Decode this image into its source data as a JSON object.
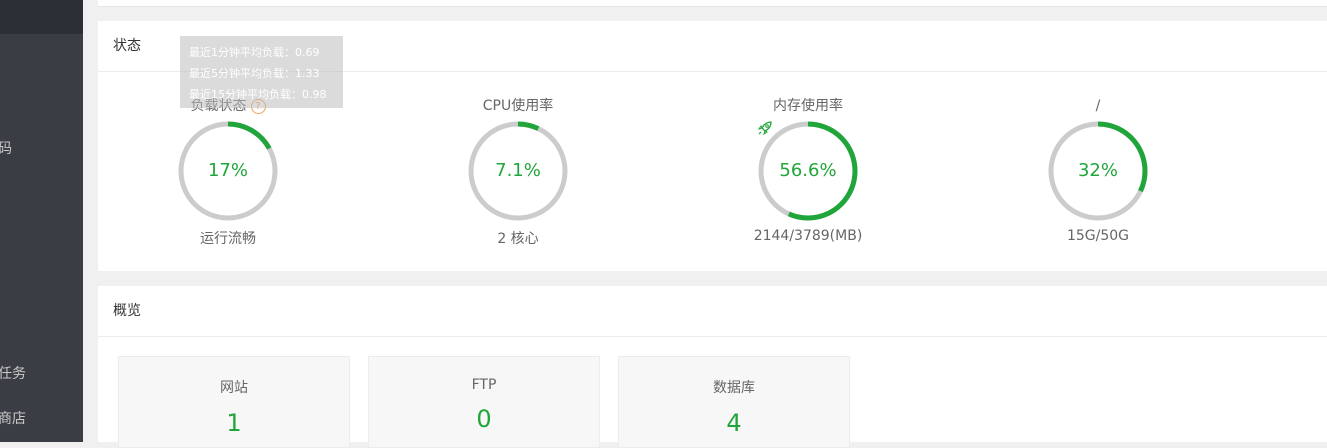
{
  "sidebar": {
    "fragments": [
      {
        "text": "码"
      },
      {
        "text": "任务"
      },
      {
        "text": "商店"
      }
    ]
  },
  "status": {
    "title": "状态",
    "tooltip": [
      "最近1分钟平均负载：0.69",
      "最近5分钟平均负载：1.33",
      "最近15分钟平均负载：0.98"
    ],
    "gauges": [
      {
        "title": "负载状态",
        "value_text": "17%",
        "percent": 17,
        "sub": "运行流畅",
        "help_icon": "question-icon"
      },
      {
        "title": "CPU使用率",
        "value_text": "7.1%",
        "percent": 7.1,
        "sub": "2 核心"
      },
      {
        "title": "内存使用率",
        "value_text": "56.6%",
        "percent": 56.6,
        "sub": "2144/3789(MB)",
        "icon": "rocket-icon"
      },
      {
        "title": "/",
        "value_text": "32%",
        "percent": 32,
        "sub": "15G/50G"
      }
    ]
  },
  "overview": {
    "title": "概览",
    "cards": [
      {
        "label": "网站",
        "value": "1"
      },
      {
        "label": "FTP",
        "value": "0"
      },
      {
        "label": "数据库",
        "value": "4"
      }
    ]
  },
  "colors": {
    "accent": "#20a53a",
    "ring_track": "#cccccc",
    "sidebar": "#3a3d44"
  }
}
